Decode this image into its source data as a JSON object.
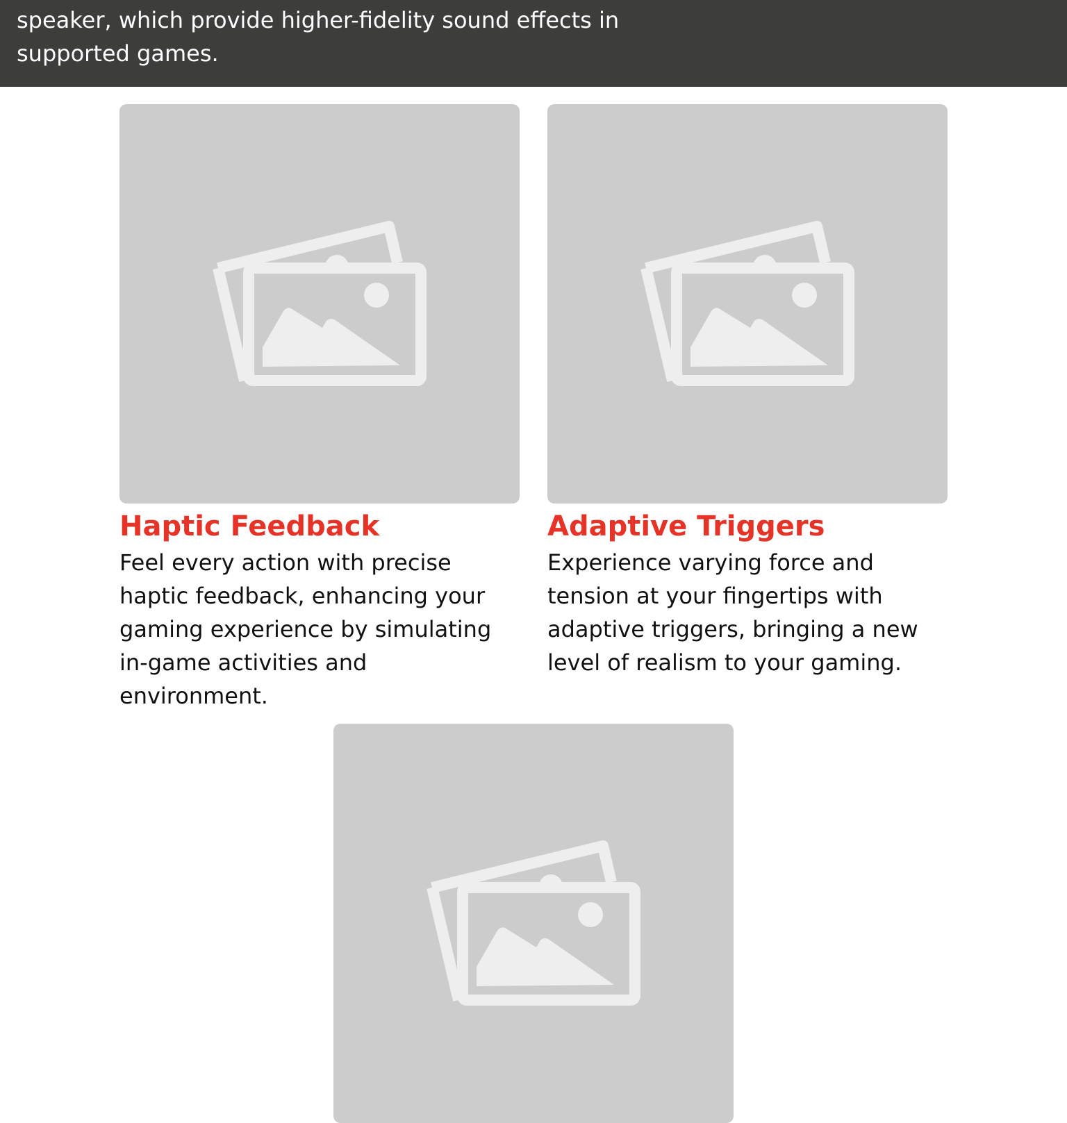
{
  "banner": {
    "line1": "speaker, which provide higher-fidelity sound effects in",
    "line2": "supported games."
  },
  "features": [
    {
      "title": "Haptic Feedback",
      "image_icon": "image-placeholder-icon",
      "description_lines": [
        "Feel every action with precise",
        "haptic feedback, enhancing your",
        "gaming experience by simulating",
        "in-game activities and",
        "environment."
      ]
    },
    {
      "title": "Adaptive Triggers",
      "image_icon": "image-placeholder-icon",
      "description_lines": [
        "Experience varying force and",
        "tension at your fingertips with",
        "adaptive triggers, bringing a new",
        "level of realism to your gaming."
      ]
    },
    {
      "image_icon": "image-placeholder-icon"
    }
  ],
  "colors": {
    "banner_bg": "#3d3d3c",
    "title_red": "#e63328",
    "placeholder_bg": "#cccccc",
    "placeholder_icon": "#eeeeee"
  }
}
